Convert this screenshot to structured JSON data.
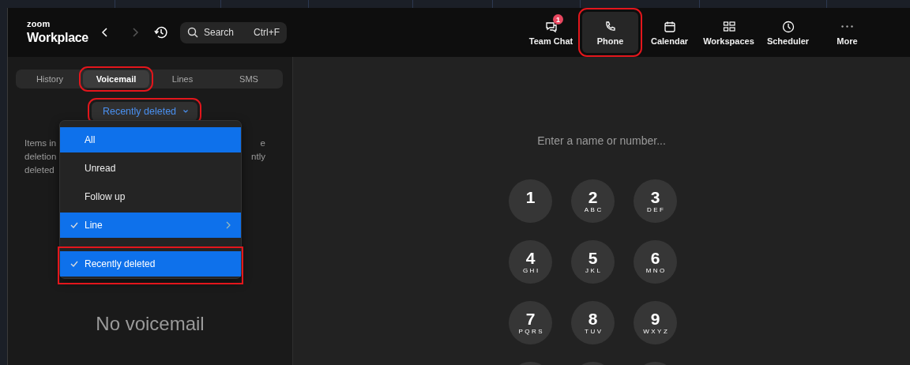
{
  "topbar": {
    "logo_small": "zoom",
    "logo_large": "Workplace",
    "back_disabled": false,
    "forward_disabled": true,
    "search": {
      "placeholder": "Search",
      "shortcut": "Ctrl+F"
    },
    "nav": [
      {
        "label": "Team Chat",
        "badge": "1",
        "selected": false,
        "highlighted": false
      },
      {
        "label": "Phone",
        "selected": true,
        "highlighted": true
      },
      {
        "label": "Calendar",
        "selected": false,
        "highlighted": false
      },
      {
        "label": "Workspaces",
        "selected": false,
        "highlighted": false
      },
      {
        "label": "Scheduler",
        "selected": false,
        "highlighted": false
      },
      {
        "label": "More",
        "selected": false,
        "highlighted": false
      }
    ]
  },
  "sidebar": {
    "tabs": [
      {
        "label": "History",
        "selected": false,
        "highlighted": false
      },
      {
        "label": "Voicemail",
        "selected": true,
        "highlighted": true
      },
      {
        "label": "Lines",
        "selected": false,
        "highlighted": false
      },
      {
        "label": "SMS",
        "selected": false,
        "highlighted": false
      }
    ],
    "filter": {
      "label": "Recently deleted",
      "highlighted": true
    },
    "note_left": [
      "Items in",
      "deletion",
      "deleted"
    ],
    "note_right": [
      "e",
      "ntly"
    ],
    "menu": {
      "groups": [
        [
          {
            "label": "All",
            "selected": true,
            "checked": false,
            "submenu": false,
            "highlighted": false
          },
          {
            "label": "Unread",
            "selected": false,
            "checked": false,
            "submenu": false,
            "highlighted": false
          },
          {
            "label": "Follow up",
            "selected": false,
            "checked": false,
            "submenu": false,
            "highlighted": false
          },
          {
            "label": "Line",
            "selected": true,
            "checked": true,
            "submenu": true,
            "highlighted": false
          }
        ],
        [
          {
            "label": "Recently deleted",
            "selected": true,
            "checked": true,
            "submenu": false,
            "highlighted": true
          }
        ]
      ]
    },
    "empty_text": "No voicemail"
  },
  "dialer": {
    "placeholder": "Enter a name or number...",
    "keys": [
      {
        "kind": "key",
        "digit": "1"
      },
      {
        "kind": "key",
        "digit": "2",
        "letters": "ABC"
      },
      {
        "kind": "key",
        "digit": "3",
        "letters": "DEF"
      },
      {
        "kind": "key",
        "digit": "4",
        "letters": "GHI"
      },
      {
        "kind": "key",
        "digit": "5",
        "letters": "JKL"
      },
      {
        "kind": "key",
        "digit": "6",
        "letters": "MNO"
      },
      {
        "kind": "key",
        "digit": "7",
        "letters": "PQRS"
      },
      {
        "kind": "key",
        "digit": "8",
        "letters": "TUV"
      },
      {
        "kind": "key",
        "digit": "9",
        "letters": "WXYZ"
      },
      {
        "kind": "cut"
      },
      {
        "kind": "cut"
      },
      {
        "kind": "cut"
      }
    ]
  }
}
